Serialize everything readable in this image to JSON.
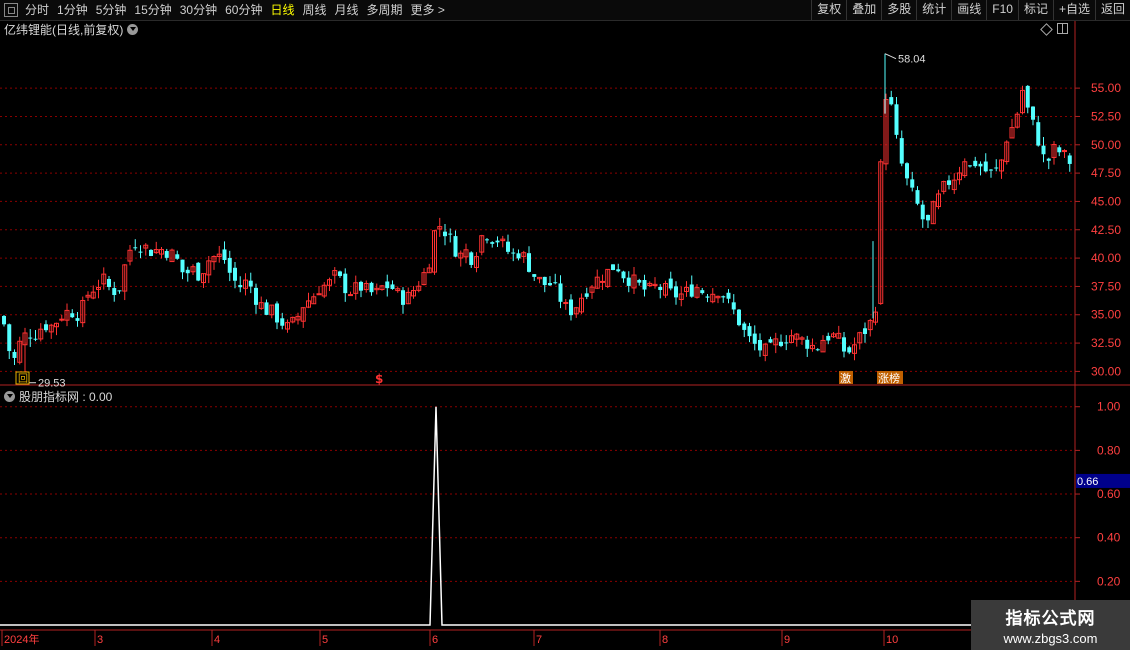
{
  "toolbar": {
    "periods": [
      "分时",
      "1分钟",
      "5分钟",
      "15分钟",
      "30分钟",
      "60分钟",
      "日线",
      "周线",
      "月线",
      "多周期",
      "更多 >"
    ],
    "active_period": "日线",
    "actions": [
      "复权",
      "叠加",
      "多股",
      "统计",
      "画线",
      "F10",
      "标记",
      "+自选",
      "返回"
    ]
  },
  "stock": {
    "title": "亿纬锂能(日线,前复权)"
  },
  "indicator": {
    "title": "股朋指标网 : 0.00",
    "current_value": "0.66"
  },
  "watermark": {
    "line1": "指标公式网",
    "line2": "www.zbgs3.com"
  },
  "markers": {
    "low_label": "29.53",
    "high_label": "58.04",
    "huitiao": "回",
    "dollar": "$",
    "ji": "激",
    "zhangbang": "涨榜"
  },
  "colors": {
    "up": "#ff3232",
    "down": "#54ffff",
    "grid": "#8b0000",
    "axis": "#b22222",
    "indicator_line": "#ffffff",
    "highlight_box": "#00008b"
  },
  "chart_data": [
    {
      "type": "candlestick",
      "title": "亿纬锂能(日线,前复权)",
      "y_ticks": [
        30.0,
        32.5,
        35.0,
        37.5,
        40.0,
        42.5,
        45.0,
        47.5,
        50.0,
        52.5,
        55.0
      ],
      "ylim": [
        28.8,
        59.6
      ],
      "low_annotation": 29.53,
      "high_annotation": 58.04,
      "grid": "dotted horizontal",
      "close_path": [
        [
          0,
          35.5
        ],
        [
          6,
          33.5
        ],
        [
          10,
          31.5
        ],
        [
          13,
          30.5
        ],
        [
          17,
          32.0
        ],
        [
          22,
          32.8
        ],
        [
          28,
          33.5
        ],
        [
          34,
          33.2
        ],
        [
          40,
          33.8
        ],
        [
          46,
          34.1
        ],
        [
          52,
          34.0
        ],
        [
          58,
          34.6
        ],
        [
          64,
          35.2
        ],
        [
          72,
          35.3
        ],
        [
          80,
          35.0
        ],
        [
          88,
          36.8
        ],
        [
          96,
          37.6
        ],
        [
          104,
          38.0
        ],
        [
          112,
          37.0
        ],
        [
          120,
          37.5
        ],
        [
          128,
          40.5
        ],
        [
          136,
          41.5
        ],
        [
          144,
          41.0
        ],
        [
          152,
          40.6
        ],
        [
          160,
          40.8
        ],
        [
          168,
          40.6
        ],
        [
          176,
          40.0
        ],
        [
          184,
          38.5
        ],
        [
          192,
          39.0
        ],
        [
          200,
          38.5
        ],
        [
          208,
          39.8
        ],
        [
          216,
          40.2
        ],
        [
          224,
          40.0
        ],
        [
          232,
          38.2
        ],
        [
          240,
          37.5
        ],
        [
          248,
          38.0
        ],
        [
          256,
          36.5
        ],
        [
          264,
          35.5
        ],
        [
          272,
          35.2
        ],
        [
          280,
          34.5
        ],
        [
          288,
          33.8
        ],
        [
          296,
          34.5
        ],
        [
          304,
          36.0
        ],
        [
          312,
          36.5
        ],
        [
          320,
          37.5
        ],
        [
          328,
          37.6
        ],
        [
          336,
          38.5
        ],
        [
          344,
          37.5
        ],
        [
          352,
          37.0
        ],
        [
          360,
          37.5
        ],
        [
          368,
          37.0
        ],
        [
          376,
          36.8
        ],
        [
          384,
          37.6
        ],
        [
          392,
          37.4
        ],
        [
          400,
          36.5
        ],
        [
          408,
          36.5
        ],
        [
          416,
          37.5
        ],
        [
          424,
          38.6
        ],
        [
          430,
          40.0
        ],
        [
          436,
          43.0
        ],
        [
          442,
          42.8
        ],
        [
          448,
          42.0
        ],
        [
          454,
          41.0
        ],
        [
          460,
          40.2
        ],
        [
          466,
          40.6
        ],
        [
          472,
          40.0
        ],
        [
          478,
          41.0
        ],
        [
          484,
          42.5
        ],
        [
          490,
          41.8
        ],
        [
          496,
          41.8
        ],
        [
          504,
          41.0
        ],
        [
          512,
          40.2
        ],
        [
          520,
          40.6
        ],
        [
          528,
          39.5
        ],
        [
          536,
          38.2
        ],
        [
          544,
          37.7
        ],
        [
          552,
          37.7
        ],
        [
          560,
          36.5
        ],
        [
          568,
          35.2
        ],
        [
          576,
          35.8
        ],
        [
          584,
          37.0
        ],
        [
          592,
          37.8
        ],
        [
          600,
          38.3
        ],
        [
          608,
          38.8
        ],
        [
          616,
          39.5
        ],
        [
          624,
          38.5
        ],
        [
          632,
          38.0
        ],
        [
          640,
          37.5
        ],
        [
          648,
          37.0
        ],
        [
          656,
          37.5
        ],
        [
          664,
          37.2
        ],
        [
          672,
          36.8
        ],
        [
          680,
          36.7
        ],
        [
          688,
          37.0
        ],
        [
          696,
          37.5
        ],
        [
          704,
          37.0
        ],
        [
          712,
          37.0
        ],
        [
          720,
          37.3
        ],
        [
          728,
          36.0
        ],
        [
          736,
          35.0
        ],
        [
          744,
          33.5
        ],
        [
          752,
          32.5
        ],
        [
          760,
          32.0
        ],
        [
          768,
          31.6
        ],
        [
          776,
          32.5
        ],
        [
          784,
          33.0
        ],
        [
          792,
          33.2
        ],
        [
          800,
          32.8
        ],
        [
          808,
          32.5
        ],
        [
          816,
          32.0
        ],
        [
          824,
          33.0
        ],
        [
          832,
          33.2
        ],
        [
          840,
          32.6
        ],
        [
          846,
          31.5
        ],
        [
          852,
          32.0
        ],
        [
          858,
          32.8
        ],
        [
          864,
          33.5
        ],
        [
          870,
          34.2
        ],
        [
          875,
          35.0
        ],
        [
          880,
          44.0
        ],
        [
          886,
          54.5
        ],
        [
          892,
          53.0
        ],
        [
          898,
          49.5
        ],
        [
          904,
          47.5
        ],
        [
          910,
          46.0
        ],
        [
          916,
          45.0
        ],
        [
          922,
          43.5
        ],
        [
          928,
          43.0
        ],
        [
          934,
          44.5
        ],
        [
          940,
          45.5
        ],
        [
          946,
          46.5
        ],
        [
          952,
          47.0
        ],
        [
          958,
          47.5
        ],
        [
          964,
          49.0
        ],
        [
          970,
          48.0
        ],
        [
          976,
          48.5
        ],
        [
          982,
          48.0
        ],
        [
          988,
          47.5
        ],
        [
          994,
          47.5
        ],
        [
          1000,
          48.0
        ],
        [
          1006,
          50.5
        ],
        [
          1012,
          51.5
        ],
        [
          1018,
          53.0
        ],
        [
          1022,
          55.0
        ],
        [
          1028,
          53.0
        ],
        [
          1034,
          51.5
        ],
        [
          1040,
          50.0
        ],
        [
          1046,
          48.0
        ],
        [
          1052,
          49.5
        ],
        [
          1058,
          49.5
        ],
        [
          1064,
          49.0
        ],
        [
          1070,
          48.5
        ],
        [
          1074,
          48.2
        ]
      ],
      "extra_highs": [
        [
          25,
          29.53
        ],
        [
          885,
          58.04
        ],
        [
          873,
          41.5
        ]
      ]
    },
    {
      "type": "line",
      "title": "股朋指标网 : 0.00",
      "y_ticks": [
        0.2,
        0.4,
        0.6,
        0.8,
        1.0
      ],
      "ylim": [
        0,
        1.04
      ],
      "series": [
        {
          "values": [
            [
              0,
              0
            ],
            [
              430,
              0
            ],
            [
              436,
              1.0
            ],
            [
              442,
              0
            ],
            [
              1075,
              0
            ]
          ]
        }
      ],
      "current_value": 0.66
    }
  ],
  "x_axis": {
    "labels": [
      [
        "2024年",
        2
      ],
      [
        "3",
        95
      ],
      [
        "4",
        212
      ],
      [
        "5",
        320
      ],
      [
        "6",
        430
      ],
      [
        "7",
        534
      ],
      [
        "8",
        660
      ],
      [
        "9",
        782
      ],
      [
        "10",
        884
      ]
    ]
  }
}
